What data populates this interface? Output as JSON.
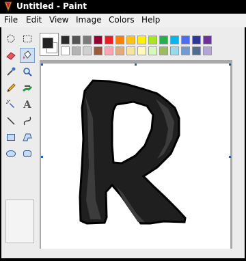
{
  "window": {
    "title": "Untitled - Paint"
  },
  "menu": {
    "items": [
      {
        "label": "File"
      },
      {
        "label": "Edit"
      },
      {
        "label": "View"
      },
      {
        "label": "Image"
      },
      {
        "label": "Colors"
      },
      {
        "label": "Help"
      }
    ]
  },
  "toolbox": {
    "tools": [
      {
        "name": "free-form-select-icon"
      },
      {
        "name": "select-icon"
      },
      {
        "name": "eraser-icon"
      },
      {
        "name": "fill-with-color-icon",
        "selected": true
      },
      {
        "name": "pick-color-icon"
      },
      {
        "name": "magnifier-icon"
      },
      {
        "name": "pencil-icon"
      },
      {
        "name": "brush-icon"
      },
      {
        "name": "airbrush-icon"
      },
      {
        "name": "text-icon",
        "label": "A"
      },
      {
        "name": "line-icon"
      },
      {
        "name": "curve-icon"
      },
      {
        "name": "rectangle-icon"
      },
      {
        "name": "polygon-icon"
      },
      {
        "name": "ellipse-icon"
      },
      {
        "name": "rounded-rectangle-icon"
      }
    ]
  },
  "colors": {
    "foreground": "#222222",
    "background": "#ffffff",
    "palette_row1": [
      "#2b2b2b",
      "#555555",
      "#7b7b7b",
      "#990030",
      "#ed1c24",
      "#ff7e00",
      "#ffc20e",
      "#fff200",
      "#a8e61d",
      "#22b14c",
      "#00b7ef",
      "#4d6df3",
      "#2f3699",
      "#6f3198"
    ],
    "palette_row2": [
      "#ffffff",
      "#b4b4b4",
      "#d0d0d0",
      "#9c5a3c",
      "#ffa3b1",
      "#e5aa7a",
      "#f5e49c",
      "#fff9bd",
      "#d3f9bc",
      "#9dbb61",
      "#99d9ea",
      "#709ad1",
      "#546d8e",
      "#b5a5d5"
    ]
  },
  "canvas": {
    "drawing": "letter R",
    "drawing_colors": {
      "fill": "#1f1f1f",
      "shade": "#3c3c3c",
      "outline": "#000000"
    }
  }
}
